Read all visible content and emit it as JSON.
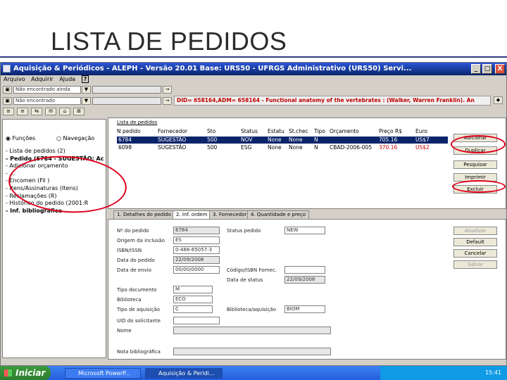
{
  "slide": {
    "title": "LISTA DE PEDIDOS"
  },
  "window": {
    "title": "Aquisição & Periódicos - ALEPH - Versão 20.01 Base: URS50 - UFRGS Administrativo (URS50) Servi...",
    "minimize": "_",
    "maximize": "□",
    "close": "X"
  },
  "menu": [
    "Arquivo",
    "Adquirir",
    "Ajuda"
  ],
  "toolbar": {
    "field1": "Não encontrado ainda",
    "field2": "Não encontrado",
    "banner": "DID= 658164,ADM= 658164 - Functional anatomy of the vertebrates : (Walker, Warren Franklin). An"
  },
  "left": {
    "radio_funcoes": "Funções",
    "radio_navegacao": "Navegação",
    "tree": [
      "- Lista de pedidos (2)",
      "- Pedido (6784 - SUGESTÃO; Ac",
      "   - Adicionar orçamento",
      "   - ...",
      "   - Encomen (Fil )",
      "   - Itens/Assinaturas (Itens)",
      "   - Reclamações (R)",
      "   - Histórico do pedido (2001:R",
      "- Inf. bibliográfica"
    ]
  },
  "grid": {
    "tab": "Lista de pedidos",
    "columns": [
      "N pedido",
      "Fornecedor",
      "Sto",
      "Status",
      "Estatu",
      "St.chec",
      "Tipo",
      "Orçamento",
      "Preço R$",
      "Euro"
    ],
    "rows": [
      [
        "6784",
        "SUGESTÃO",
        "500",
        "NOV",
        "None",
        "None",
        "N",
        "",
        "705.16",
        "US$7"
      ],
      [
        "6098",
        "SUGESTÃO",
        "500",
        "ESG",
        "None",
        "None",
        "N",
        "CBAD-2006-005",
        "370.16",
        "US$2"
      ]
    ],
    "buttons": [
      "Adicionar",
      "Duplicar",
      "Pesquisar",
      "Imprimir",
      "Excluir"
    ]
  },
  "form": {
    "tabs": [
      "1. Detalhes do pedido",
      "2. Inf. ordem",
      "3. Fornecedor",
      "4. Quantidade e preço"
    ],
    "labels": {
      "n_pedido": "Nº do pedido",
      "origem": "Origem da inclusão",
      "isbn": "ISBN/ISSN",
      "data_pedido": "Data do pedido",
      "data_envio": "Data de envio",
      "tipo_doc": "Tipo documento",
      "biblioteca": "Biblioteca",
      "tipo_aquisicao": "Tipo de aquisição",
      "uid": "UID do solicitante",
      "nome": "Nome",
      "nota": "Nota bibliográfica",
      "status_pedido": "Status pedido",
      "cod_forn": "Código/ISBN Fornec.",
      "data_status": "Data de status",
      "bib_aquisicao": "Biblioteca/aquisição"
    },
    "values": {
      "n_pedido": "6784",
      "origem": "ES",
      "isbn": "0-486-65057-3",
      "data_pedido": "22/09/2008",
      "data_envio": "00/00/0000",
      "tipo_doc": "M",
      "biblioteca": "ECO",
      "tipo_aquisicao": "C",
      "status_pedido": "NEW",
      "data_status": "22/09/2008",
      "bib_aquisicao": "BIOM"
    },
    "buttons": [
      "Atualizar",
      "Default",
      "Cancelar",
      "Salvar"
    ]
  },
  "taskbar": {
    "start": "Iniciar",
    "tasks": [
      "Microsoft PowerP...",
      "Aquisição & Peridi..."
    ],
    "clock": "15:41"
  },
  "accent": {
    "highlight": "#e0001b",
    "title_blue": "#0a246a",
    "rule": "#2e3c7e"
  }
}
